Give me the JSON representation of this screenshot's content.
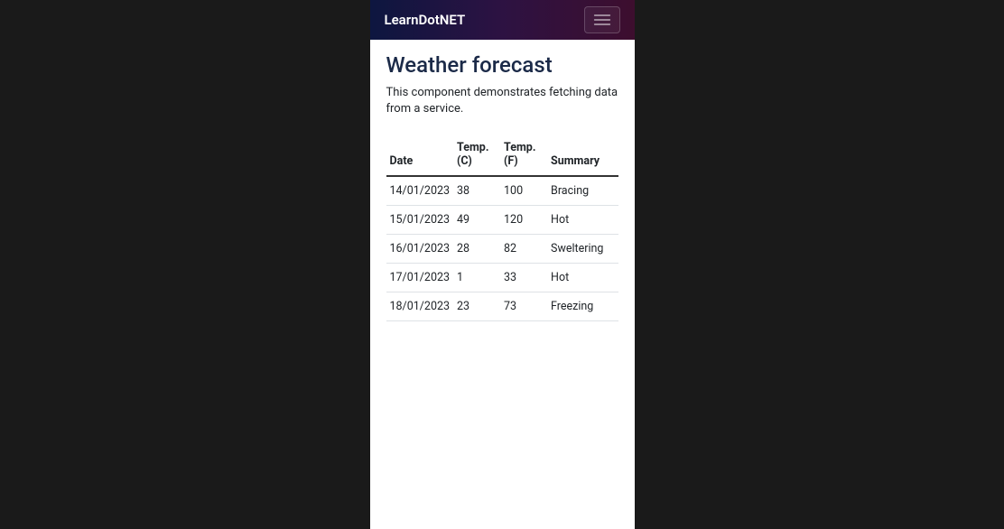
{
  "navbar": {
    "brand": "LearnDotNET"
  },
  "page": {
    "title": "Weather forecast",
    "description": "This component demonstrates fetching data from a service."
  },
  "table": {
    "headers": {
      "date": "Date",
      "tempC": "Temp. (C)",
      "tempF": "Temp. (F)",
      "summary": "Summary"
    },
    "rows": [
      {
        "date": "14/01/2023",
        "tempC": "38",
        "tempF": "100",
        "summary": "Bracing"
      },
      {
        "date": "15/01/2023",
        "tempC": "49",
        "tempF": "120",
        "summary": "Hot"
      },
      {
        "date": "16/01/2023",
        "tempC": "28",
        "tempF": "82",
        "summary": "Sweltering"
      },
      {
        "date": "17/01/2023",
        "tempC": "1",
        "tempF": "33",
        "summary": "Hot"
      },
      {
        "date": "18/01/2023",
        "tempC": "23",
        "tempF": "73",
        "summary": "Freezing"
      }
    ]
  }
}
